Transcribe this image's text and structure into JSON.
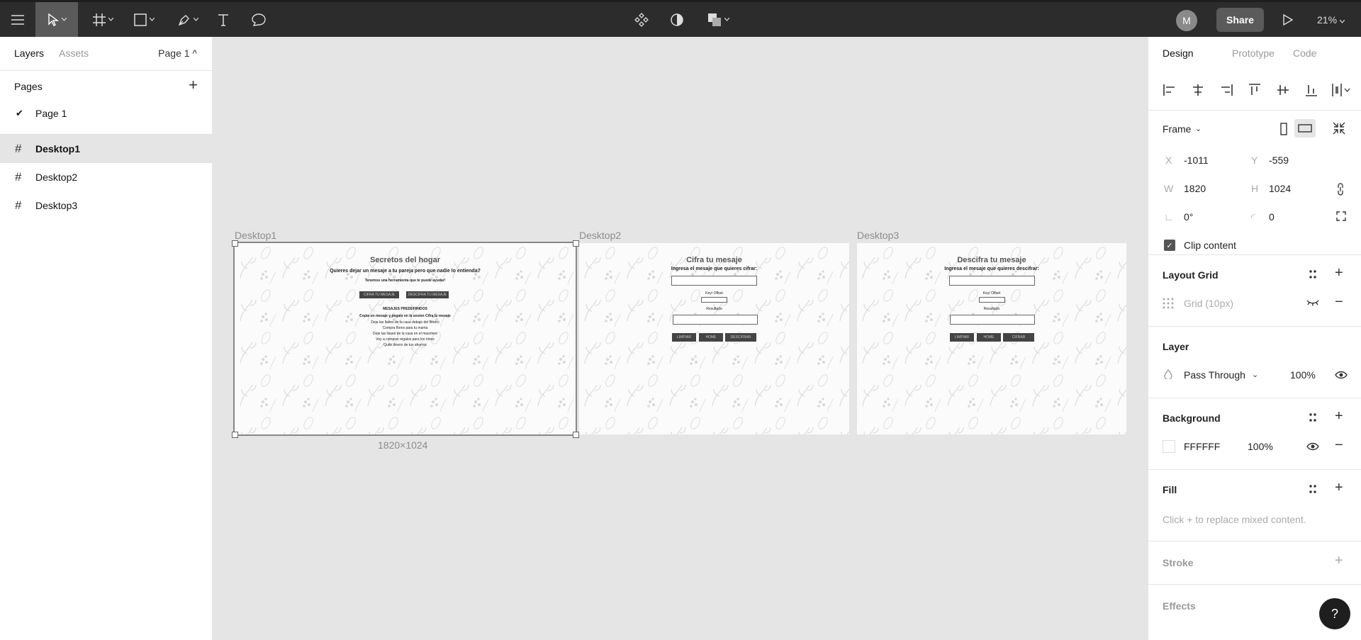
{
  "toolbar": {
    "menu_icon": "hamburger-icon",
    "avatar_initial": "M",
    "share_label": "Share",
    "zoom_label": "21%"
  },
  "left_panel": {
    "tabs": [
      "Layers",
      "Assets"
    ],
    "page_selector": "Page 1 ^",
    "pages_title": "Pages",
    "pages": [
      "Page 1"
    ],
    "layers": [
      "Desktop1",
      "Desktop2",
      "Desktop3"
    ]
  },
  "canvas": {
    "frames": [
      {
        "label": "Desktop1",
        "texts": {
          "title": "Secretos del hogar",
          "question": "Quieres dejar un mesaje a tu pareja pero que nadie lo entienda?",
          "sub": "Tenemos una herramienta que te puede ayudar!",
          "btn1": "CIFRA TU MESAJE",
          "btn2": "DESCIFRA TU MESAJE",
          "predefined_title": "MESAJES PREDEFINIDOS",
          "copy_hint": "Copia un mesaje y pegalo en la sesion Cifra tu mesaje",
          "msg1": "Deja las llaves de la casa debajo del florero",
          "msg2": "Compra flores para tu mama",
          "msg3": "Deje las llaves de la casa en el macetero",
          "msg4": "Voy a comprar regalos para los ninos",
          "msg5": "Quite dinero de tus ahorros"
        }
      },
      {
        "label": "Desktop2",
        "texts": {
          "title": "Cifra tu mesaje",
          "prompt": "Ingresa el mesaje que quieres cifrar:",
          "key": "Key/ Offset",
          "result": "Resultado",
          "btn1": "LIMPIAR",
          "btn2": "HOME",
          "btn3": "DESCIFRAR"
        }
      },
      {
        "label": "Desktop3",
        "texts": {
          "title": "Descifra tu mesaje",
          "prompt": "Ingresa el mesaje que quieres descifrar:",
          "key": "Key/ Offset",
          "result": "Resultado",
          "btn1": "LIMPIAR",
          "btn2": "HOME",
          "btn3": "CIFRAR"
        }
      }
    ],
    "selection_size": "1820×1024"
  },
  "right_panel": {
    "tabs": [
      "Design",
      "Prototype",
      "Code"
    ],
    "frame_label": "Frame",
    "x_label": "X",
    "x_value": "-1011",
    "y_label": "Y",
    "y_value": "-559",
    "w_label": "W",
    "w_value": "1820",
    "h_label": "H",
    "h_value": "1024",
    "rotation_value": "0°",
    "radius_value": "0",
    "clip_content_label": "Clip content",
    "layout_grid_title": "Layout Grid",
    "grid_item": "Grid (10px)",
    "layer_title": "Layer",
    "blend_mode": "Pass Through",
    "layer_opacity": "100%",
    "background_title": "Background",
    "bg_hex": "FFFFFF",
    "bg_opacity": "100%",
    "fill_title": "Fill",
    "fill_hint": "Click + to replace mixed content.",
    "stroke_title": "Stroke",
    "effects_title": "Effects",
    "help_label": "?"
  },
  "colors": {
    "toolbar_bg": "#2c2c2c",
    "canvas_bg": "#e5e5e5",
    "panel_bg": "#ffffff",
    "selected_layer_bg": "#e5e5e5"
  }
}
